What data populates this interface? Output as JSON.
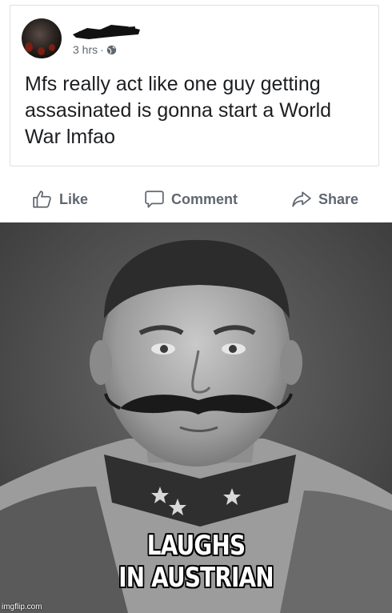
{
  "post": {
    "timestamp": "3 hrs",
    "separator": "·",
    "privacy_icon": "globe-icon",
    "text": "Mfs really act like one guy getting assasinated is gonna start a World War lmfao"
  },
  "actions": {
    "like_label": "Like",
    "comment_label": "Comment",
    "share_label": "Share"
  },
  "meme": {
    "caption_line1": "LAUGHS",
    "caption_line2": "IN AUSTRIAN",
    "watermark": "imgflip.com"
  },
  "colors": {
    "action_text": "#606770",
    "post_text": "#1c1e21",
    "card_border": "#dddfe2"
  }
}
